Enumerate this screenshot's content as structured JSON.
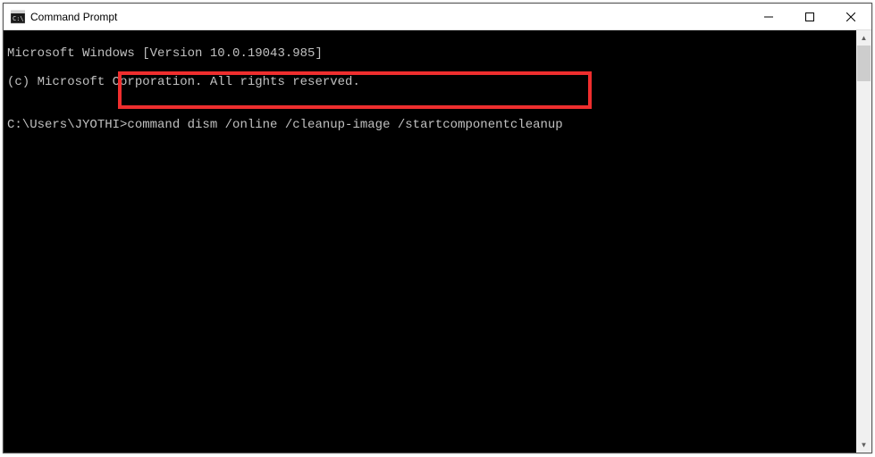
{
  "window": {
    "title": "Command Prompt",
    "icon": "cmd-icon"
  },
  "terminal": {
    "line1": "Microsoft Windows [Version 10.0.19043.985]",
    "line2": "(c) Microsoft Corporation. All rights reserved.",
    "blank": "",
    "prompt": "C:\\Users\\JYOTHI>",
    "command": "command dism /online /cleanup-image /startcomponentcleanup"
  },
  "highlight": {
    "color": "#ef2e2e"
  }
}
